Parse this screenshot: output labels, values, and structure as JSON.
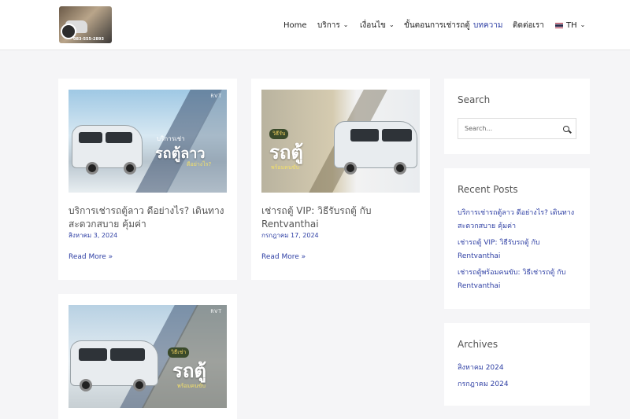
{
  "header": {
    "logo_phone": "083-555-2893",
    "nav": [
      {
        "label": "Home",
        "has_dropdown": false
      },
      {
        "label": "บริการ",
        "has_dropdown": true
      },
      {
        "label": "เงื่อนไข",
        "has_dropdown": true
      },
      {
        "label": "ขั้นตอนการเช่ารถตู้",
        "has_dropdown": false
      },
      {
        "label": "บทความ",
        "has_dropdown": false,
        "active": true
      },
      {
        "label": "ติดต่อเรา",
        "has_dropdown": false
      }
    ],
    "language": {
      "label": "TH",
      "has_dropdown": true
    }
  },
  "posts": [
    {
      "title": "บริการเช่ารถตู้ลาว ดีอย่างไร? เดินทางสะดวกสบาย คุ้มค่า",
      "date": "สิงหาคม 3, 2024",
      "read_more": "Read More »",
      "thumb": {
        "line1": "บริการเช่า",
        "line2": "รถตู้ลาว",
        "line3": "ดีอย่างไร?",
        "mark": "RVT"
      }
    },
    {
      "title": "เช่ารถตู้ VIP: วิธีรับรถตู้ กับ Rentvanthai",
      "date": "กรกฎาคม 17, 2024",
      "read_more": "Read More »",
      "thumb": {
        "pill": "วิธีรับ",
        "line2": "รถตู้",
        "line3": "พร้อมคนขับ"
      }
    },
    {
      "title": "",
      "date": "",
      "read_more": "",
      "thumb": {
        "pill": "วิธีเช่า",
        "line2": "รถตู้",
        "line3": "พร้อมคนขับ",
        "mark": "RVT"
      }
    }
  ],
  "sidebar": {
    "search": {
      "title": "Search",
      "placeholder": "Search..."
    },
    "recent": {
      "title": "Recent Posts",
      "items": [
        "บริการเช่ารถตู้ลาว ดีอย่างไร? เดินทางสะดวกสบาย คุ้มค่า",
        "เช่ารถตู้ VIP: วิธีรับรถตู้ กับ Rentvanthai",
        "เช่ารถตู้พร้อมคนขับ: วิธีเช่ารถตู้ กับ Rentvanthai"
      ]
    },
    "archives": {
      "title": "Archives",
      "items": [
        "สิงหาคม 2024",
        "กรกฎาคม 2024"
      ]
    }
  },
  "colors": {
    "accent": "#2e3fa4",
    "background": "#f5f5f7"
  }
}
